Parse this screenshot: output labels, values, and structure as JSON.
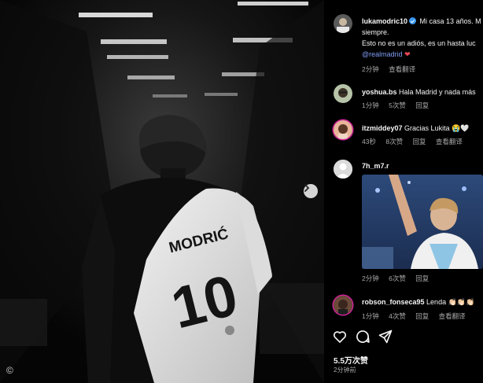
{
  "media": {
    "jersey_name": "MODRIĆ",
    "jersey_number": "10",
    "copyright": "©"
  },
  "caption": {
    "username": "lukamodric10",
    "line1": "Mi casa 13 años. M",
    "line2": "siempre.",
    "line3": "Esto no es un adiós, es un hasta luc",
    "mention": "@realmadrid",
    "time": "2分钟",
    "translate": "查看翻译"
  },
  "comments": [
    {
      "username": "yoshua.bs",
      "text": "Hala Madrid y nada más",
      "time": "1分钟",
      "likes": "5次赞",
      "reply": "回复"
    },
    {
      "username": "itzmiddey07",
      "text": "Gracias Lukita 😭🤍",
      "time": "43秒",
      "likes": "8次赞",
      "reply": "回复",
      "translate": "查看翻译"
    },
    {
      "username": "7h_m7.r",
      "text": "",
      "time": "2分钟",
      "likes": "6次赞",
      "reply": "回复"
    },
    {
      "username": "robson_fonseca95",
      "text": "Lenda 👏🏻👏🏻👏🏻",
      "time": "1分钟",
      "likes": "4次赞",
      "reply": "回复",
      "translate": "查看翻译"
    }
  ],
  "footer": {
    "likes": "5.5万次赞",
    "time_ago": "2分钟前"
  },
  "icons": [
    "chevron-right-icon",
    "heart-icon",
    "comment-icon",
    "share-icon",
    "verified-icon"
  ],
  "colors": {
    "background": "#000000",
    "mention": "#7f9cf5",
    "verified": "#3897f0",
    "heart": "#ed4956",
    "muted_text": "#a8a8a8"
  }
}
